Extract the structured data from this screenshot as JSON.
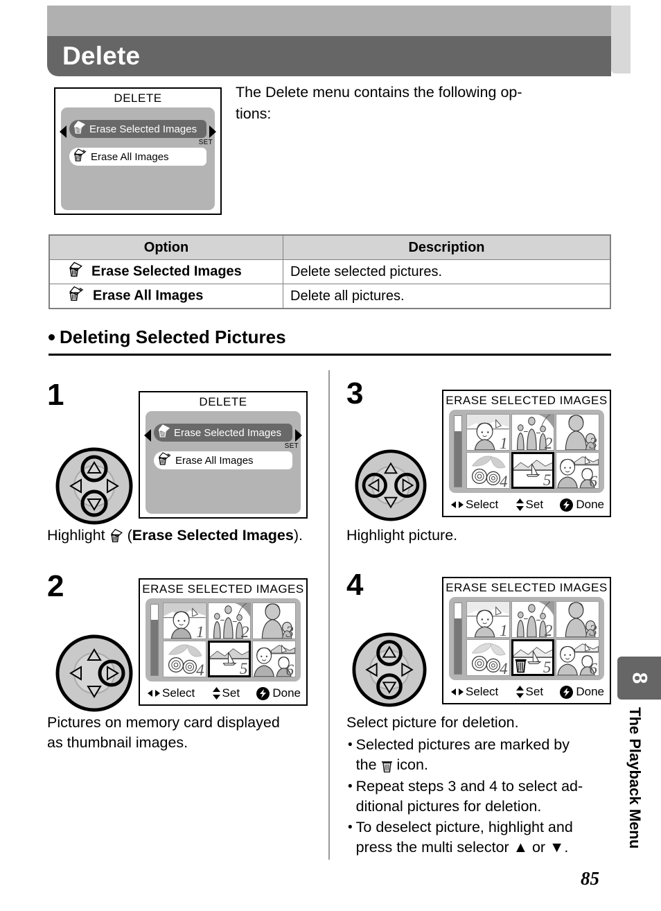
{
  "header": {
    "title": "Delete"
  },
  "intro": {
    "line1": "The Delete menu contains the following op-",
    "line2": "tions:"
  },
  "lcd_top": {
    "title": "DELETE",
    "selected_item": "Erase Selected Images",
    "unselected_item": "Erase All Images",
    "set_tag": "SET"
  },
  "table": {
    "headers": [
      "Option",
      "Description"
    ],
    "rows": [
      {
        "icon": "trash-single-image-icon",
        "option": "Erase Selected Images",
        "description": "Delete selected pictures."
      },
      {
        "icon": "trash-all-images-icon",
        "option": "Erase All Images",
        "description": "Delete all pictures."
      }
    ]
  },
  "section": {
    "heading": "Deleting Selected Pictures"
  },
  "steps": [
    {
      "number": "1",
      "selector": {
        "up": true,
        "down": true,
        "left": false,
        "right": false
      },
      "screen": {
        "kind": "menu",
        "title": "DELETE",
        "selected_item": "Erase Selected Images",
        "unselected_item": "Erase All Images",
        "set_tag": "SET"
      },
      "caption_plain_1": "Highlight ",
      "caption_icon": "trash-single-image-icon",
      "caption_plain_2": " (",
      "caption_bold": "Erase Selected Images",
      "caption_plain_3": ")."
    },
    {
      "number": "2",
      "selector": {
        "up": false,
        "down": false,
        "left": false,
        "right": true
      },
      "screen": {
        "kind": "thumbnails",
        "title": "ERASE SELECTED IMAGES",
        "thumbnails": [
          {
            "number": "1",
            "subject": "woman-with-sailboat",
            "current": false,
            "marked": false
          },
          {
            "number": "2",
            "subject": "woman-with-two-children",
            "current": false,
            "marked": false
          },
          {
            "number": "3",
            "subject": "woman-with-child",
            "current": false,
            "marked": false
          },
          {
            "number": "4",
            "subject": "flowers",
            "current": false,
            "marked": false
          },
          {
            "number": "5",
            "subject": "lake-with-sailboat",
            "current": true,
            "marked": false
          },
          {
            "number": "6",
            "subject": "two-people-at-lake",
            "current": false,
            "marked": false
          }
        ],
        "bottom_bar": {
          "select": "Select",
          "set": "Set",
          "done": "Done"
        }
      },
      "caption_line1": "Pictures on memory card displayed",
      "caption_line2": "as thumbnail images."
    },
    {
      "number": "3",
      "selector": {
        "up": false,
        "down": false,
        "left": true,
        "right": true
      },
      "screen": {
        "kind": "thumbnails",
        "title": "ERASE SELECTED IMAGES",
        "thumbnails": [
          {
            "number": "1",
            "subject": "woman-with-sailboat",
            "current": false,
            "marked": false
          },
          {
            "number": "2",
            "subject": "woman-with-two-children",
            "current": false,
            "marked": false
          },
          {
            "number": "3",
            "subject": "woman-with-child",
            "current": false,
            "marked": false
          },
          {
            "number": "4",
            "subject": "flowers",
            "current": false,
            "marked": false
          },
          {
            "number": "5",
            "subject": "lake-with-sailboat",
            "current": true,
            "marked": false
          },
          {
            "number": "6",
            "subject": "two-people-at-lake",
            "current": false,
            "marked": false
          }
        ],
        "bottom_bar": {
          "select": "Select",
          "set": "Set",
          "done": "Done"
        }
      },
      "caption_line1": "Highlight picture."
    },
    {
      "number": "4",
      "selector": {
        "up": true,
        "down": true,
        "left": false,
        "right": false
      },
      "screen": {
        "kind": "thumbnails",
        "title": "ERASE SELECTED IMAGES",
        "thumbnails": [
          {
            "number": "1",
            "subject": "woman-with-sailboat",
            "current": false,
            "marked": false
          },
          {
            "number": "2",
            "subject": "woman-with-two-children",
            "current": false,
            "marked": false
          },
          {
            "number": "3",
            "subject": "woman-with-child",
            "current": false,
            "marked": false
          },
          {
            "number": "4",
            "subject": "flowers",
            "current": false,
            "marked": false
          },
          {
            "number": "5",
            "subject": "lake-with-sailboat",
            "current": true,
            "marked": true
          },
          {
            "number": "6",
            "subject": "two-people-at-lake",
            "current": false,
            "marked": false
          }
        ],
        "bottom_bar": {
          "select": "Select",
          "set": "Set",
          "done": "Done"
        }
      },
      "caption_line1": "Select picture for deletion.",
      "bullets": [
        {
          "line1": "Selected  pictures  are  marked  by",
          "pre2": "the ",
          "icon": "trash-icon",
          "post2": " icon."
        },
        {
          "line1": "Repeat steps 3 and 4 to select ad-",
          "line2": "ditional pictures for deletion."
        },
        {
          "line1": "To deselect picture, highlight and",
          "pre2": "press the multi selector ",
          "glyph_up": "▲",
          "mid2": " or ",
          "glyph_down": "▼",
          "post2": "."
        }
      ]
    }
  ],
  "sidebar": {
    "chapter_number": "8",
    "chapter_title": "The Playback Menu"
  },
  "footer": {
    "page_number": "85"
  },
  "colors": {
    "header_bar": "#666666",
    "header_top": "#b0b0b0",
    "lcd_body": "#b4b4b4",
    "menu_selected": "#696969",
    "table_header": "#d4d4d4"
  }
}
